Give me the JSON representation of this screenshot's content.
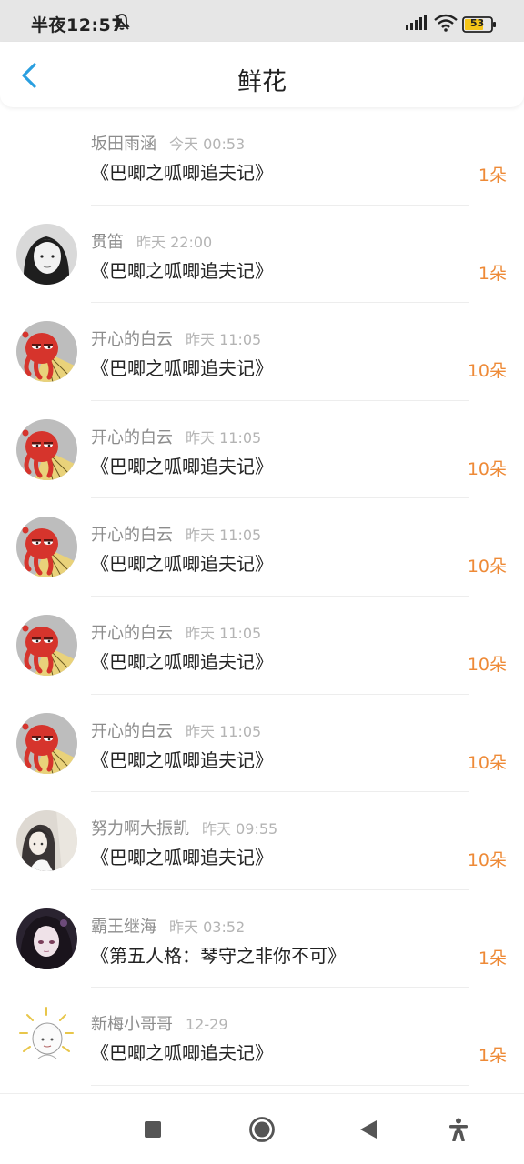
{
  "status": {
    "time": "半夜12:57",
    "battery": "53",
    "icons": [
      "bell-muted-icon",
      "signal-icon",
      "wifi-icon",
      "battery-icon"
    ]
  },
  "header": {
    "title": "鲜花",
    "back_icon": "chevron-left-icon",
    "accent": "#2a9fe0"
  },
  "items": [
    {
      "name": "坂田雨涵",
      "time": "今天 00:53",
      "book": "《巴唧之呱唧追夫记》",
      "count": "1朵",
      "avatar": "none"
    },
    {
      "name": "贯笛",
      "time": "昨天 22:00",
      "book": "《巴唧之呱唧追夫记》",
      "count": "1朵",
      "avatar": "girl-bw"
    },
    {
      "name": "开心的白云",
      "time": "昨天 11:05",
      "book": "《巴唧之呱唧追夫记》",
      "count": "10朵",
      "avatar": "red-octopus"
    },
    {
      "name": "开心的白云",
      "time": "昨天 11:05",
      "book": "《巴唧之呱唧追夫记》",
      "count": "10朵",
      "avatar": "red-octopus"
    },
    {
      "name": "开心的白云",
      "time": "昨天 11:05",
      "book": "《巴唧之呱唧追夫记》",
      "count": "10朵",
      "avatar": "red-octopus"
    },
    {
      "name": "开心的白云",
      "time": "昨天 11:05",
      "book": "《巴唧之呱唧追夫记》",
      "count": "10朵",
      "avatar": "red-octopus"
    },
    {
      "name": "开心的白云",
      "time": "昨天 11:05",
      "book": "《巴唧之呱唧追夫记》",
      "count": "10朵",
      "avatar": "red-octopus"
    },
    {
      "name": "努力啊大振凯",
      "time": "昨天 09:55",
      "book": "《巴唧之呱唧追夫记》",
      "count": "10朵",
      "avatar": "anime-girl-light"
    },
    {
      "name": "霸王继海",
      "time": "昨天 03:52",
      "book": "《第五人格：琴守之非你不可》",
      "count": "1朵",
      "avatar": "anime-girl-dark"
    },
    {
      "name": "新梅小哥哥",
      "time": "12-29",
      "book": "《巴唧之呱唧追夫记》",
      "count": "1朵",
      "avatar": "sun-sketch"
    }
  ],
  "colors": {
    "count": "#ee8a37",
    "username": "#8c8c8c",
    "time": "#b4b4b4"
  },
  "nav": [
    "stop-square-icon",
    "home-circle-icon",
    "back-triangle-icon",
    "accessibility-icon"
  ]
}
